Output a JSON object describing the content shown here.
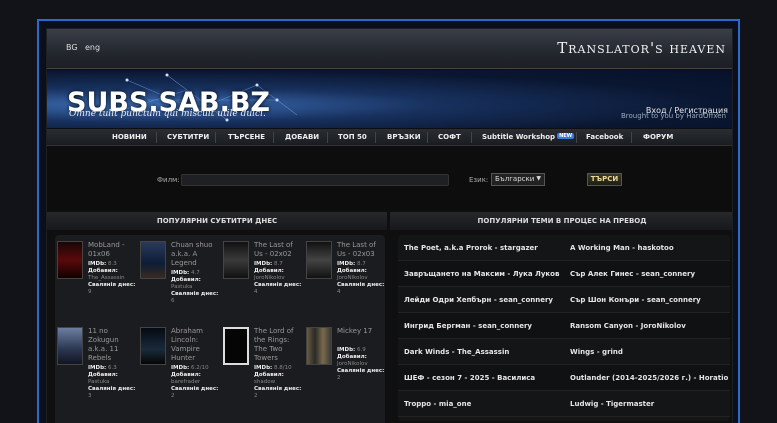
{
  "header": {
    "lang_bg": "BG",
    "lang_en": "eng",
    "site_title": "Translator's heaven",
    "logo": "SUBS.SAB.BZ",
    "motto": "Omne tulit punctum qui miscuit utile dulci.",
    "login": "Вход / Регистрация",
    "brought_by": "Brought to you by HardOffxen"
  },
  "nav": {
    "items": [
      "НОВИНИ",
      "СУБТИТРИ",
      "ТЪРСЕНЕ",
      "ДОБАВИ",
      "ТОП 50",
      "ВРЪЗКИ",
      "СОФТ",
      "Subtitle Workshop",
      "Facebook",
      "ФОРУМ"
    ],
    "new_badge": "NEW"
  },
  "search": {
    "film_label": "Филм:",
    "lang_label": "Език:",
    "lang_value": "Български",
    "button": "ТЪРСИ"
  },
  "sections": {
    "popular_subs": "ПОПУЛЯРНИ СУБТИТРИ ДНЕС",
    "popular_topics": "ПОПУЛЯРНИ ТЕМИ В ПРОЦЕС НА ПРЕВОД"
  },
  "labels": {
    "imdb": "IMDb:",
    "added": "Добавил:",
    "downloads": "Свалянiя днес:"
  },
  "subs": [
    {
      "title": "MobLand - 01x06",
      "imdb": "8.3",
      "by": "The_Assassin",
      "dl": "9"
    },
    {
      "title": "Chuan shuo a.k.a. A Legend",
      "imdb": "4.7",
      "by": "Pastuka",
      "dl": "6"
    },
    {
      "title": "The Last of Us - 02x02",
      "imdb": "8.7",
      "by": "JoroNikolov",
      "dl": "4"
    },
    {
      "title": "The Last of Us - 02x03",
      "imdb": "8.7",
      "by": "JoroNikolov",
      "dl": "4"
    },
    {
      "title": "11 no Zokugun a.k.a. 11 Rebels",
      "imdb": "6.3",
      "by": "Pastuka",
      "dl": "3"
    },
    {
      "title": "Abraham Lincoln: Vampire Hunter",
      "imdb": "6.2/10",
      "by": "barefrader",
      "dl": "2"
    },
    {
      "title": "The Lord of the Rings: The Two Towers",
      "imdb": "8.8/10",
      "by": "shadow",
      "dl": "2"
    },
    {
      "title": "Mickey 17",
      "imdb": "6.9",
      "by": "JoroNikolov",
      "dl": "2"
    }
  ],
  "topics": [
    [
      "The Poet, a.k.a Prorok - stargazer",
      "A Working Man - haskotoo"
    ],
    [
      "Завръщането на Максим - Лука Луков",
      "Сър Алек Гинес - sean_connery"
    ],
    [
      "Лейди Одри Хепбърн - sean_connery",
      "Сър Шон Конъри - sean_connery"
    ],
    [
      "Ингрид Бергман - sean_connery",
      "Ransom Canyon - JoroNikolov"
    ],
    [
      "Dark Winds - The_Assassin",
      "Wings - grind"
    ],
    [
      "ШЕФ - сезон 7 - 2025 - Василиса",
      "Outlander (2014-2025/2026 г.) - Horatio"
    ],
    [
      "Troppo - mia_one",
      "Ludwig - Tigermaster"
    ]
  ],
  "colors": {
    "frame_border": "#2a6bcc",
    "banner": "#17305d",
    "button_text": "#f0d890"
  }
}
